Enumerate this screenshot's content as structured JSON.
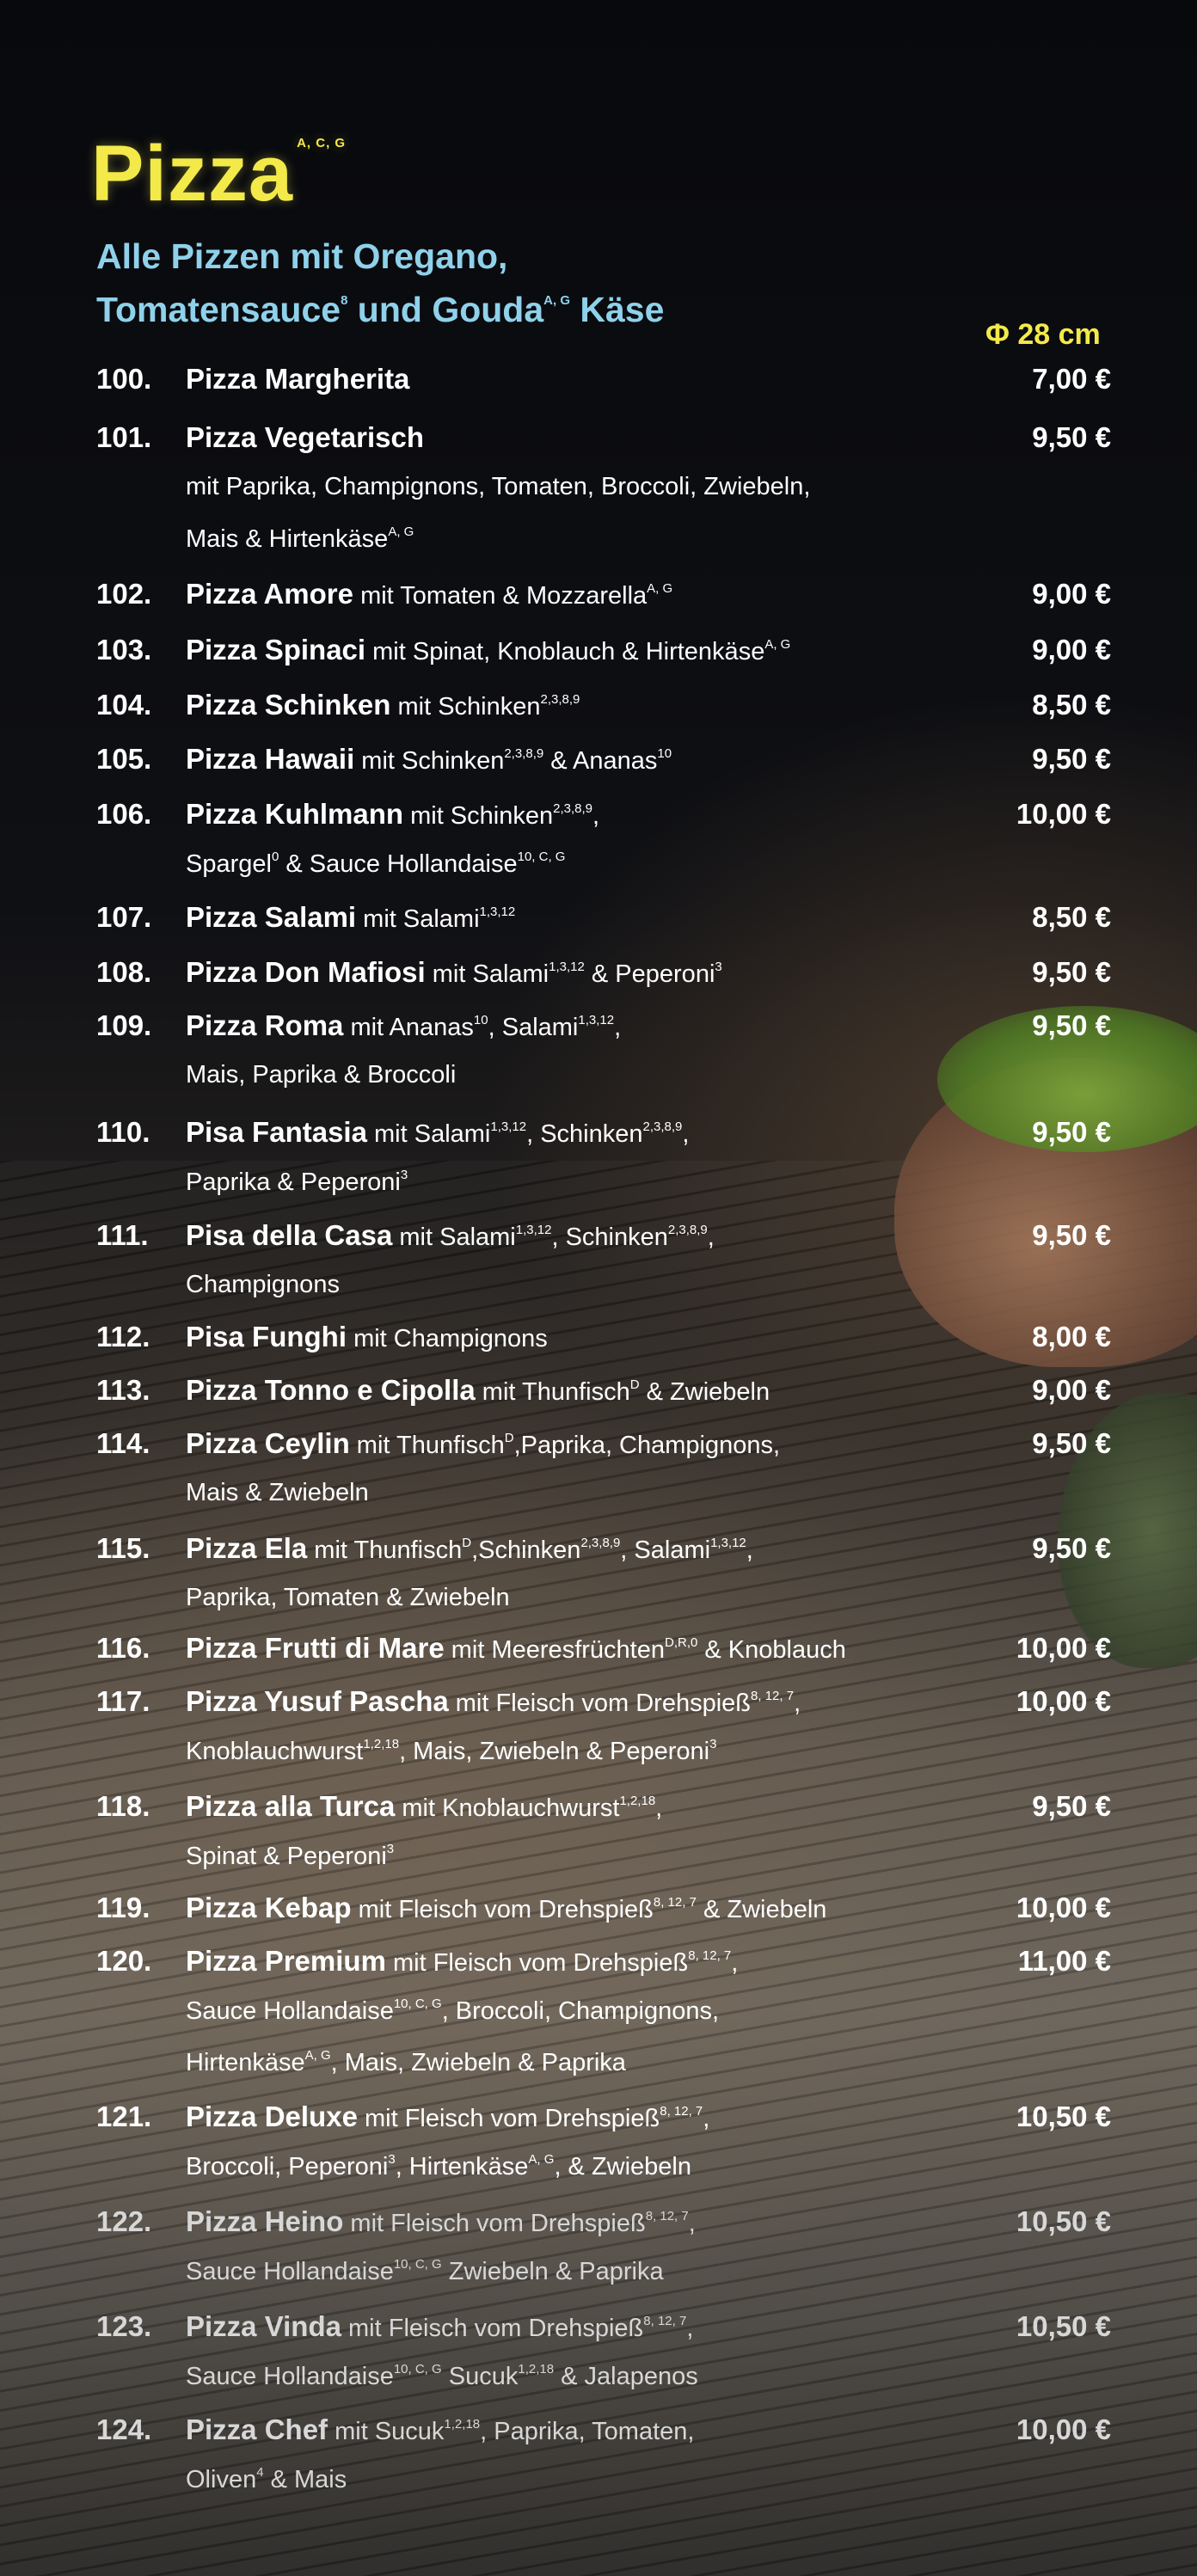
{
  "header": {
    "title": "Pizza",
    "title_allergens": "A, C, G",
    "subtitle_line1": "Alle Pizzen mit Oregano,",
    "subtitle_line2_a": "Tomatensauce",
    "subtitle_line2_sup1": "8",
    "subtitle_line2_b": " und Gouda",
    "subtitle_line2_sup2": "A, G",
    "subtitle_line2_c": " Käse",
    "size_label": "Φ 28 cm"
  },
  "items": [
    {
      "num": "100.",
      "name": "Pizza Margherita",
      "desc": "",
      "desc2": "",
      "price": "7,00 €"
    },
    {
      "num": "101.",
      "name": "Pizza Vegetarisch",
      "desc": "",
      "desc2": "mit Paprika, Champignons, Tomaten, Broccoli, Zwiebeln,",
      "desc3": "Mais & Hirtenkäse",
      "desc3_sup": "A, G",
      "price": "9,50 €"
    },
    {
      "num": "102.",
      "name": "Pizza Amore",
      "desc": " mit Tomaten & Mozzarella",
      "desc_sup": "A, G",
      "price": "9,00 €"
    },
    {
      "num": "103.",
      "name": "Pizza Spinaci",
      "desc": " mit Spinat, Knoblauch & Hirtenkäse",
      "desc_sup": "A, G",
      "price": "9,00 €"
    },
    {
      "num": "104.",
      "name": "Pizza Schinken",
      "desc": " mit Schinken",
      "desc_sup": "2,3,8,9",
      "price": "8,50 €"
    },
    {
      "num": "105.",
      "name": "Pizza Hawaii",
      "desc": " mit Schinken",
      "desc_sup": "2,3,8,9",
      "desc_b": " & Ananas",
      "desc_b_sup": "10",
      "price": "9,50 €"
    },
    {
      "num": "106.",
      "name": "Pizza Kuhlmann",
      "desc": " mit Schinken",
      "desc_sup": "2,3,8,9",
      "desc_b": ",",
      "desc2": "Spargel",
      "desc2_sup": "0",
      "desc2_b": " & Sauce Hollandaise",
      "desc2_b_sup": "10, C, G",
      "price": "10,00 €"
    },
    {
      "num": "107.",
      "name": "Pizza Salami",
      "desc": " mit Salami",
      "desc_sup": "1,3,12",
      "price": "8,50 €"
    },
    {
      "num": "108.",
      "name": "Pizza Don Mafiosi",
      "desc": " mit Salami",
      "desc_sup": "1,3,12",
      "desc_b": " & Peperoni",
      "desc_b_sup": "3",
      "price": "9,50 €"
    },
    {
      "num": "109.",
      "name": "Pizza Roma",
      "desc": " mit Ananas",
      "desc_sup": "10",
      "desc_b": ", Salami",
      "desc_b_sup": "1,3,12",
      "desc_c": ",",
      "desc2": "Mais, Paprika & Broccoli",
      "price": "9,50 €"
    },
    {
      "num": "110.",
      "name": "Pisa Fantasia",
      "desc": " mit Salami",
      "desc_sup": "1,3,12",
      "desc_b": ", Schinken",
      "desc_b_sup": "2,3,8,9",
      "desc_c": ",",
      "desc2": "Paprika & Peperoni",
      "desc2_sup": "3",
      "price": "9,50 €"
    },
    {
      "num": "111.",
      "name": "Pisa della Casa",
      "desc": " mit Salami",
      "desc_sup": "1,3,12",
      "desc_b": ", Schinken",
      "desc_b_sup": "2,3,8,9",
      "desc_c": ",",
      "desc2": "Champignons",
      "price": "9,50 €"
    },
    {
      "num": "112.",
      "name": "Pisa Funghi",
      "desc": " mit Champignons",
      "price": "8,00 €"
    },
    {
      "num": "113.",
      "name": "Pizza Tonno e Cipolla",
      "desc": " mit Thunfisch",
      "desc_sup": "D",
      "desc_b": " & Zwiebeln",
      "price": "9,00 €"
    },
    {
      "num": "114.",
      "name": "Pizza Ceylin",
      "desc": " mit Thunfisch",
      "desc_sup": "D",
      "desc_b": ",Paprika, Champignons,",
      "desc2": " Mais & Zwiebeln",
      "price": "9,50 €"
    },
    {
      "num": "115.",
      "name": "Pizza Ela",
      "desc": " mit Thunfisch",
      "desc_sup": "D",
      "desc_b": ",Schinken",
      "desc_b_sup": "2,3,8,9",
      "desc_c": ", Salami",
      "desc_c_sup": "1,3,12",
      "desc_d": ",",
      "desc2": "Paprika, Tomaten & Zwiebeln",
      "price": "9,50 €"
    },
    {
      "num": "116.",
      "name": "Pizza Frutti di Mare",
      "desc": " mit Meeresfrüchten",
      "desc_sup": "D,R,0",
      "desc_b": " & Knoblauch",
      "price": "10,00 €"
    },
    {
      "num": "117.",
      "name": "Pizza Yusuf Pascha",
      "desc": " mit Fleisch vom Drehspieß",
      "desc_sup": "8, 12, 7",
      "desc_b": ",",
      "desc2": "Knoblauchwurst",
      "desc2_sup": "1,2,18",
      "desc2_b": ", Mais, Zwiebeln & Peperoni",
      "desc2_b_sup": "3",
      "price": "10,00 €"
    },
    {
      "num": "118.",
      "name": "Pizza alla Turca",
      "desc": " mit Knoblauchwurst",
      "desc_sup": "1,2,18",
      "desc_b": ",",
      "desc2": "Spinat & Peperoni",
      "desc2_sup": "3",
      "price": "9,50 €"
    },
    {
      "num": "119.",
      "name": "Pizza Kebap",
      "desc": " mit Fleisch vom Drehspieß",
      "desc_sup": "8, 12, 7",
      "desc_b": " & Zwiebeln",
      "price": "10,00 €"
    },
    {
      "num": "120.",
      "name": "Pizza Premium",
      "desc": " mit Fleisch vom Drehspieß",
      "desc_sup": "8, 12, 7",
      "desc_b": ",",
      "desc2": "Sauce Hollandaise",
      "desc2_sup": "10, C, G",
      "desc2_b": ", Broccoli, Champignons,",
      "desc3": "Hirtenkäse",
      "desc3_sup": "A, G",
      "desc3_b": ", Mais, Zwiebeln & Paprika",
      "price": "11,00 €"
    },
    {
      "num": "121.",
      "name": "Pizza Deluxe",
      "desc": " mit Fleisch vom Drehspieß",
      "desc_sup": "8, 12, 7",
      "desc_b": ",",
      "desc2": "Broccoli, Peperoni",
      "desc2_sup": "3",
      "desc2_b": ", Hirtenkäse",
      "desc2_b_sup": "A, G",
      "desc2_c": ", & Zwiebeln",
      "price": "10,50 €"
    },
    {
      "num": "122.",
      "name": "Pizza Heino",
      "desc": " mit Fleisch vom Drehspieß",
      "desc_sup": "8, 12, 7",
      "desc_b": ",",
      "desc2": "Sauce Hollandaise",
      "desc2_sup": "10, C, G",
      "desc2_b": " Zwiebeln & Paprika",
      "price": "10,50 €"
    },
    {
      "num": "123.",
      "name": "Pizza Vinda",
      "desc": " mit Fleisch vom Drehspieß",
      "desc_sup": "8, 12, 7",
      "desc_b": ",",
      "desc2": "Sauce Hollandaise",
      "desc2_sup": "10, C, G",
      "desc2_b": " Sucuk",
      "desc2_b_sup": "1,2,18",
      "desc2_c": " & Jalapenos",
      "price": "10,50 €"
    },
    {
      "num": "124.",
      "name": "Pizza Chef",
      "desc": " mit Sucuk",
      "desc_sup": "1,2,18",
      "desc_b": ", Paprika, Tomaten,",
      "desc2": "Oliven",
      "desc2_sup": "4",
      "desc2_b": " & Mais",
      "price": "10,00 €"
    }
  ]
}
